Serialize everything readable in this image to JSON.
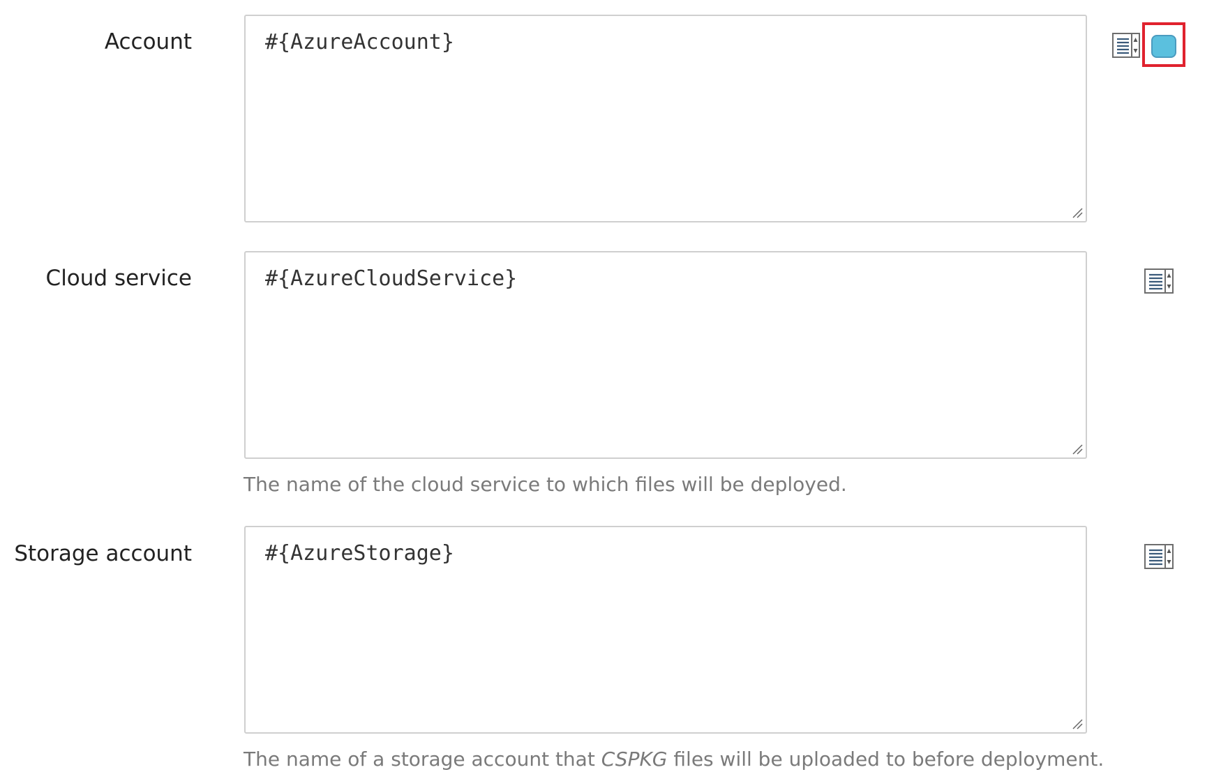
{
  "colors": {
    "toggle_fill": "#5bc0de",
    "highlight_border": "#e0222e",
    "help_text": "#7a7a7a"
  },
  "fields": [
    {
      "label": "Account",
      "value": "#{AzureAccount}",
      "icon": "list-select-icon",
      "help": ""
    },
    {
      "label": "Cloud service",
      "value": "#{AzureCloudService}",
      "icon": "list-select-icon",
      "help": "The name of the cloud service to which files will be deployed."
    },
    {
      "label": "Storage account",
      "value": "#{AzureStorage}",
      "icon": "list-select-icon",
      "help_parts": {
        "before": "The name of a storage account that ",
        "emphasis": "CSPKG",
        "after": " files will be uploaded to before deployment."
      }
    }
  ],
  "account_toggle": {
    "icon": "custom-expression-toggle-icon",
    "highlighted": true
  }
}
